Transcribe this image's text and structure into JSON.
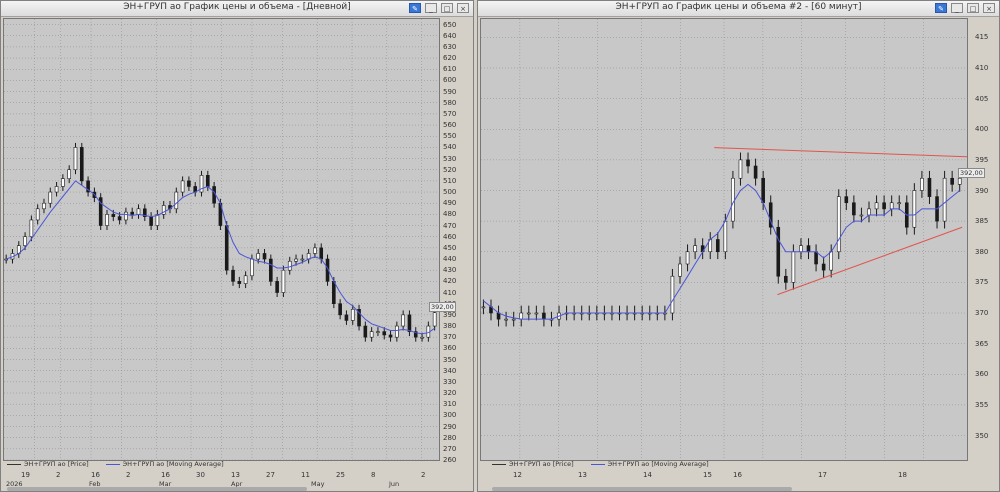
{
  "left": {
    "title": "ЭН+ГРУП ао График цены и объема - [Дневной]",
    "buttons": {
      "pen": "✎",
      "min": "_",
      "max": "□",
      "close": "×"
    },
    "yaxis": [
      "650",
      "640",
      "630",
      "620",
      "610",
      "600",
      "590",
      "580",
      "570",
      "560",
      "550",
      "540",
      "530",
      "520",
      "510",
      "500",
      "490",
      "480",
      "470",
      "460",
      "450",
      "440",
      "430",
      "420",
      "410",
      "400",
      "390",
      "380",
      "370",
      "360",
      "350",
      "340",
      "330",
      "320",
      "310",
      "300",
      "290",
      "280",
      "270",
      "260"
    ],
    "price_label": "392,00",
    "legend": [
      {
        "label": "ЭН+ГРУП ао [Price]"
      },
      {
        "label": "ЭН+ГРУП ао [Moving Average]"
      }
    ],
    "xaxis_days": [
      "19",
      "2",
      "16",
      "2",
      "16",
      "30",
      "13",
      "27",
      "11",
      "25",
      "8",
      "2"
    ],
    "xaxis_months": [
      "2026",
      "Feb",
      "Mar",
      "Apr",
      "May",
      "Jun"
    ]
  },
  "right": {
    "title": "ЭН+ГРУП ао График цены и объема #2 - [60 минут]",
    "buttons": {
      "pen": "✎",
      "min": "_",
      "max": "□",
      "close": "×"
    },
    "yaxis": [
      "415",
      "410",
      "405",
      "400",
      "395",
      "390",
      "385",
      "380",
      "375",
      "370",
      "365",
      "360",
      "355",
      "350"
    ],
    "price_label": "392,00",
    "legend": [
      {
        "label": "ЭН+ГРУП ао [Price]"
      },
      {
        "label": "ЭН+ГРУП ао [Moving Average]"
      }
    ],
    "xaxis_days": [
      "12",
      "13",
      "14",
      "15",
      "16",
      "17",
      "18"
    ]
  },
  "colors": {
    "bg": "#c8c8c8",
    "grid": "#8a8a8a",
    "candle": "#1a1a1a",
    "ma": "#4a55d8",
    "trend": "#e0554c"
  },
  "chart_data": [
    {
      "type": "candlestick",
      "title": "ЭН+ГРУП ао График цены и объема - [Дневной]",
      "ylim": [
        260,
        655
      ],
      "series": [
        {
          "name": "ЭН+ГРУП ао [Price]",
          "values": [
            440,
            445,
            452,
            460,
            475,
            485,
            490,
            500,
            505,
            512,
            520,
            540,
            510,
            500,
            495,
            470,
            480,
            478,
            475,
            482,
            480,
            485,
            478,
            470,
            480,
            488,
            485,
            500,
            510,
            505,
            500,
            515,
            505,
            490,
            470,
            430,
            420,
            418,
            425,
            440,
            445,
            440,
            420,
            410,
            430,
            438,
            440,
            440,
            445,
            450,
            440,
            420,
            400,
            390,
            385,
            395,
            380,
            370,
            375,
            375,
            372,
            370,
            380,
            390,
            375,
            370,
            370,
            380,
            392
          ]
        },
        {
          "name": "ЭН+ГРУП ао [Moving Average]",
          "values": [
            440,
            442,
            445,
            450,
            458,
            466,
            474,
            482,
            489,
            496,
            503,
            510,
            506,
            502,
            498,
            490,
            486,
            482,
            480,
            480,
            479,
            480,
            479,
            478,
            479,
            482,
            485,
            490,
            495,
            498,
            500,
            503,
            505,
            500,
            490,
            470,
            455,
            445,
            442,
            440,
            438,
            437,
            435,
            432,
            432,
            433,
            435,
            437,
            440,
            442,
            440,
            432,
            420,
            410,
            402,
            398,
            392,
            386,
            382,
            380,
            378,
            376,
            376,
            377,
            376,
            374,
            373,
            374,
            378
          ]
        }
      ]
    },
    {
      "type": "candlestick",
      "title": "ЭН+ГРУП ао График цены и объема #2 - [60 минут]",
      "ylim": [
        346,
        418
      ],
      "series": [
        {
          "name": "ЭН+ГРУП ао [Price]",
          "values": [
            371,
            370,
            369,
            369,
            369,
            370,
            370,
            370,
            369,
            369,
            370,
            370,
            370,
            370,
            370,
            370,
            370,
            370,
            370,
            370,
            370,
            370,
            370,
            370,
            370,
            376,
            378,
            380,
            381,
            380,
            382,
            380,
            385,
            392,
            395,
            394,
            392,
            388,
            384,
            376,
            375,
            380,
            381,
            380,
            378,
            377,
            380,
            389,
            388,
            386,
            386,
            387,
            388,
            387,
            388,
            388,
            384,
            390,
            392,
            389,
            385,
            392,
            391,
            392
          ]
        },
        {
          "name": "ЭН+ГРУП ао [Moving Average]",
          "values": [
            372,
            371,
            370,
            369.5,
            369.2,
            369,
            369,
            369,
            369,
            369,
            369.5,
            370,
            370,
            370,
            370,
            370,
            370,
            370,
            370,
            370,
            370,
            370,
            370,
            370,
            370,
            372,
            374,
            376,
            378,
            380,
            382,
            383,
            385,
            388,
            390,
            391,
            390,
            388,
            385,
            382,
            380,
            380,
            380,
            380,
            380,
            379,
            380,
            382,
            384,
            385,
            385,
            386,
            386,
            386,
            387,
            387,
            386,
            386,
            387,
            387,
            387,
            388,
            389,
            390
          ]
        }
      ]
    }
  ]
}
